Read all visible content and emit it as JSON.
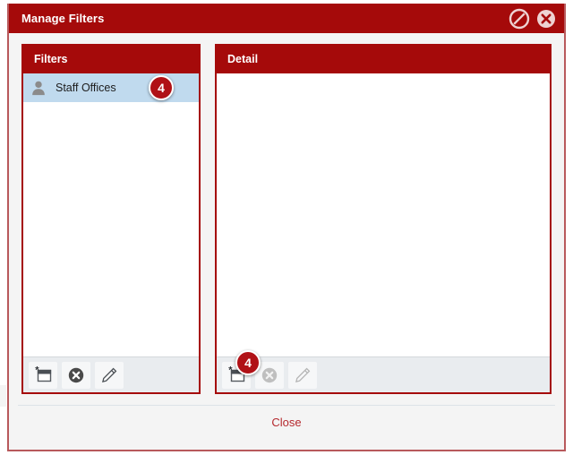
{
  "window": {
    "title": "Manage Filters",
    "actions": [
      {
        "name": "block-icon",
        "label": "Block"
      },
      {
        "name": "close-icon",
        "label": "Close"
      }
    ]
  },
  "colors": {
    "brand_red": "#a50a0a",
    "badge_red": "#b01116",
    "selection_blue": "#c0daee",
    "toolbar_gray": "#e9ecef",
    "body_gray": "#f4f4f4",
    "close_text_red": "#b5292e"
  },
  "filters_panel": {
    "header": "Filters",
    "rows": [
      {
        "label": "Staff Offices",
        "icon": "user-icon",
        "selected": true,
        "badge": "4"
      }
    ],
    "toolbar": [
      {
        "name": "new-filter-button",
        "icon": "new-window-icon",
        "label": "New",
        "disabled": false
      },
      {
        "name": "delete-filter-button",
        "icon": "delete-circle-icon",
        "label": "Delete",
        "disabled": false
      },
      {
        "name": "edit-filter-button",
        "icon": "pencil-icon",
        "label": "Edit",
        "disabled": false
      }
    ]
  },
  "detail_panel": {
    "header": "Detail",
    "rows": [],
    "toolbar": [
      {
        "name": "new-detail-button",
        "icon": "new-window-icon",
        "label": "New",
        "disabled": false,
        "badge": "4"
      },
      {
        "name": "delete-detail-button",
        "icon": "delete-circle-icon",
        "label": "Delete",
        "disabled": true
      },
      {
        "name": "edit-detail-button",
        "icon": "pencil-icon",
        "label": "Edit",
        "disabled": true
      }
    ]
  },
  "footer": {
    "close_label": "Close"
  }
}
